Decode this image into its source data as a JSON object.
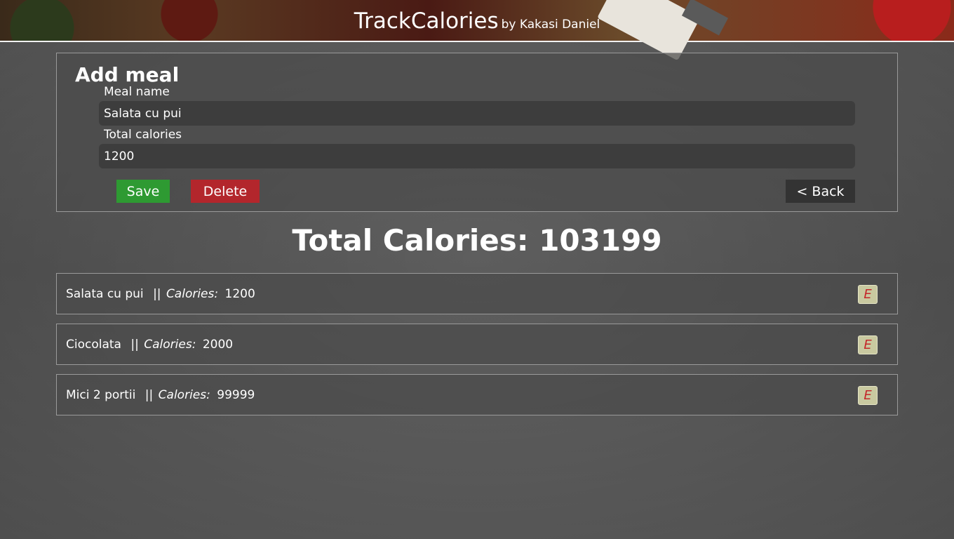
{
  "header": {
    "title": "TrackCalories",
    "byline": "by Kakasi Daniel"
  },
  "form": {
    "heading": "Add meal",
    "meal_name_label": "Meal name",
    "meal_name_value": "Salata cu pui",
    "calories_label": "Total calories",
    "calories_value": "1200",
    "save_label": "Save",
    "delete_label": "Delete",
    "back_label": "< Back"
  },
  "total": {
    "text": "Total Calories: 103199"
  },
  "meals": [
    {
      "name": "Salata cu pui",
      "separator": "||",
      "calories_label": "Calories:",
      "calories": "1200",
      "edit_label": "E"
    },
    {
      "name": "Ciocolata",
      "separator": "||",
      "calories_label": "Calories:",
      "calories": "2000",
      "edit_label": "E"
    },
    {
      "name": "Mici 2 portii",
      "separator": "||",
      "calories_label": "Calories:",
      "calories": "99999",
      "edit_label": "E"
    }
  ],
  "colors": {
    "save": "#2e9a32",
    "delete": "#b3262c",
    "back": "#333333",
    "edit_letter": "#c4262a"
  }
}
